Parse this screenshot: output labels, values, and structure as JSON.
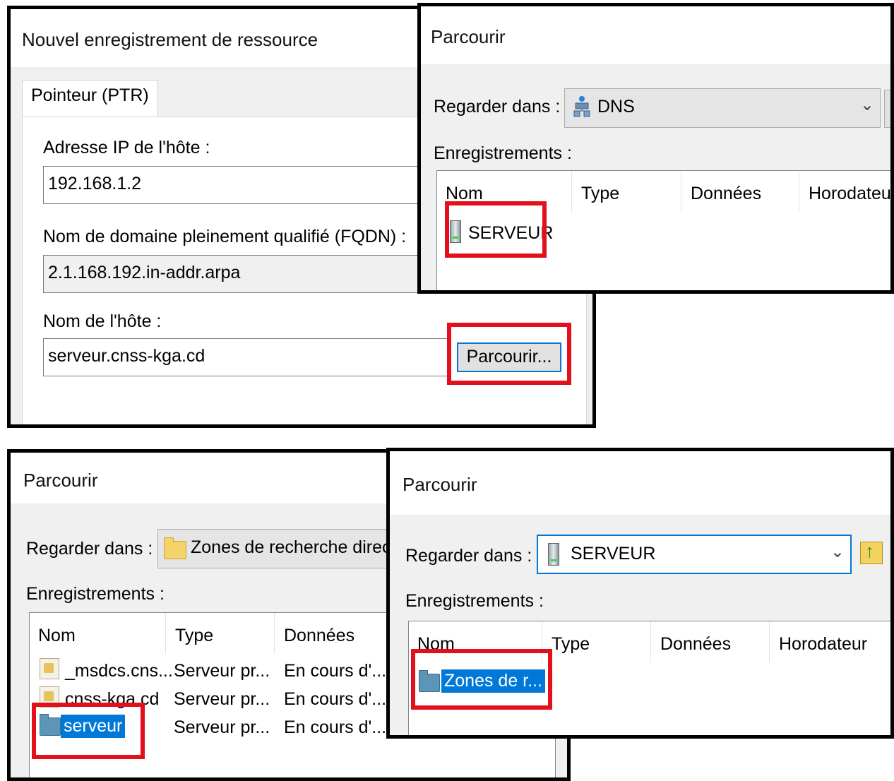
{
  "dialog_new_record": {
    "title": "Nouvel enregistrement de ressource",
    "tab_label": "Pointeur (PTR)",
    "ip_label": "Adresse IP de l'hôte :",
    "ip_value": "192.168.1.2",
    "fqdn_label": "Nom de domaine pleinement qualifié (FQDN) :",
    "fqdn_value": "2.1.168.192.in-addr.arpa",
    "host_label": "Nom de l'hôte :",
    "host_value": "serveur.cnss-kga.cd",
    "browse_button": "Parcourir..."
  },
  "browse_dns": {
    "title": "Parcourir",
    "look_in_label": "Regarder dans :",
    "look_in_value": "DNS",
    "records_label": "Enregistrements :",
    "columns": [
      "Nom",
      "Type",
      "Données",
      "Horodateur"
    ],
    "rows": [
      {
        "name": "SERVEUR",
        "icon": "server-icon"
      }
    ]
  },
  "browse_zones": {
    "title": "Parcourir",
    "look_in_label": "Regarder dans :",
    "look_in_value": "Zones de recherche directes",
    "records_label": "Enregistrements :",
    "columns": [
      "Nom",
      "Type",
      "Données"
    ],
    "rows": [
      {
        "name": "_msdcs.cns...",
        "type": "Serveur pr...",
        "data": "En cours d'..."
      },
      {
        "name": "cnss-kga.cd",
        "type": "Serveur pr...",
        "data": "En cours d'..."
      },
      {
        "name": "serveur",
        "type": "Serveur pr...",
        "data": "En cours d'..."
      }
    ]
  },
  "browse_server": {
    "title": "Parcourir",
    "look_in_label": "Regarder dans :",
    "look_in_value": "SERVEUR",
    "records_label": "Enregistrements :",
    "columns": [
      "Nom",
      "Type",
      "Données",
      "Horodateur"
    ],
    "rows": [
      {
        "name": "Zones de r...",
        "icon": "zone-folder-icon"
      }
    ]
  },
  "colors": {
    "highlight": "#e3101b",
    "selection": "#0078d7"
  }
}
